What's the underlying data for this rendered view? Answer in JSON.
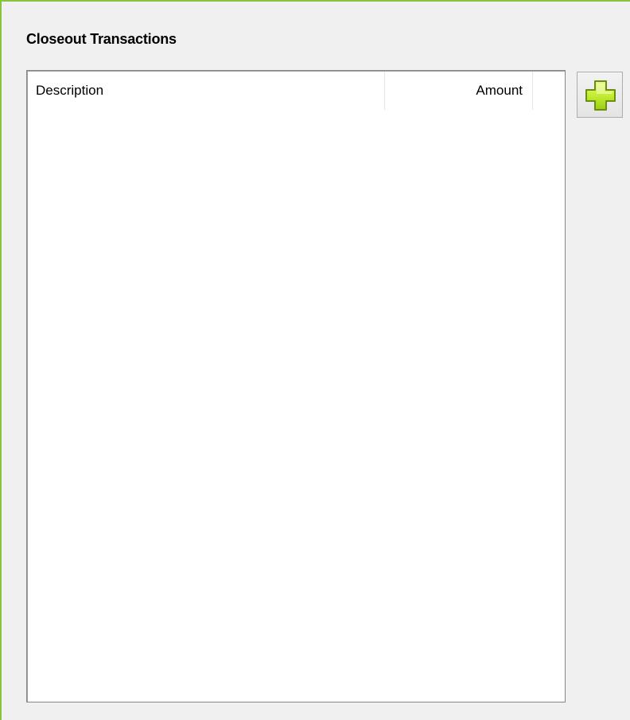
{
  "section": {
    "title": "Closeout Transactions"
  },
  "table": {
    "columns": [
      {
        "label": "Description"
      },
      {
        "label": "Amount"
      }
    ],
    "rows": []
  },
  "toolbar": {
    "add_icon": "plus-icon",
    "add_icon_color": "#b5e61d"
  },
  "colors": {
    "frame_border": "#86c43c",
    "panel_background": "#f0f0f0",
    "list_background": "#ffffff"
  }
}
